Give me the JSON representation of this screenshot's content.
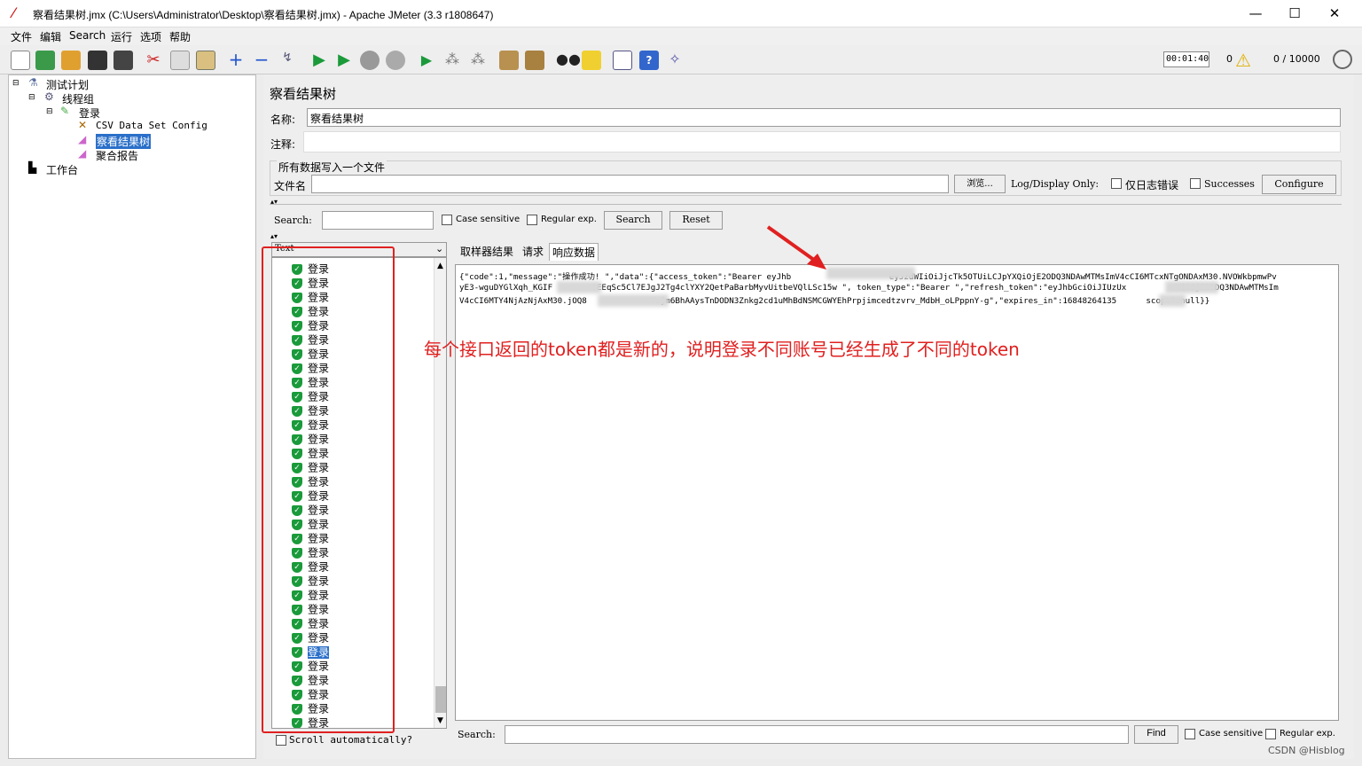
{
  "window": {
    "title": "察看结果树.jmx (C:\\Users\\Administrator\\Desktop\\察看结果树.jmx) - Apache JMeter (3.3 r1808647)",
    "minimize": "—",
    "maximize": "☐",
    "close": "✕"
  },
  "menu": [
    "文件",
    "编辑",
    "Search",
    "运行",
    "选项",
    "帮助"
  ],
  "toolbar": {
    "timer": "00:01:40",
    "errors": "0",
    "threads": "0 / 10000",
    "icons": [
      "new-icon",
      "templates-icon",
      "open-icon",
      "save-icon",
      "save-as-icon",
      "cut-icon",
      "copy-icon",
      "paste-icon",
      "expand-icon",
      "collapse-icon",
      "toggle-icon",
      "start-icon",
      "start-no-pause-icon",
      "stop-icon",
      "shutdown-icon",
      "remote-start-icon",
      "remote-stop-icon",
      "remote-shutdown-icon",
      "clear-icon",
      "clear-all-icon",
      "search-icon",
      "reset-search-icon",
      "function-helper-icon",
      "help-icon",
      "log-icon"
    ]
  },
  "tree": {
    "plan": "测试计划",
    "threadgroup": "线程组",
    "sampler": "登录",
    "csv": "CSV Data Set Config",
    "viewer": "察看结果树",
    "aggregate": "聚合报告",
    "workbench": "工作台"
  },
  "panel": {
    "title": "察看结果树",
    "name_label": "名称:",
    "name_value": "察看结果树",
    "comment_label": "注释:",
    "file_group": "所有数据写入一个文件",
    "filename_label": "文件名",
    "browse": "浏览...",
    "log_display": "Log/Display Only:",
    "errors_only": "仅日志错误",
    "successes": "Successes",
    "configure": "Configure",
    "search_label": "Search:",
    "case_sensitive": "Case sensitive",
    "regex": "Regular exp.",
    "search_btn": "Search",
    "reset_btn": "Reset",
    "list_header": "Text",
    "scroll_auto": "Scroll automatically?",
    "tabs": [
      "取样器结果",
      "请求",
      "响应数据"
    ],
    "bottom_search_label": "Search:",
    "find_btn": "Find",
    "case_sensitive2": "Case sensitive",
    "regex2": "Regular exp."
  },
  "results": {
    "label": "登录",
    "count": 33,
    "selected_index": 27
  },
  "response": {
    "line1": "{\"code\":1,\"message\":\"操作成功! \",\"data\":{\"access_token\":\"Bearer eyJhb                    eyJzdWIiOiJjcTk5OTUiLCJpYXQiOjE2ODQ3NDAwMTMsImV4cCI6MTcxNTgONDAxM30.NVOWkbpmwPv",
    "line2": "yE3-wguDYGlXqh_KGIF        0EEqSc5Cl7EJgJ2Tg4clYXY2QetPaBarbMyvUitbeVQlLSc15w \", token_type\":\"Bearer \",\"refresh_token\":\"eyJhbGciOiJIUzUx          XQiOjE2ODQ3NDAwMTMsIm",
    "line3": "V4cCI6MTY4NjAzNjAxM30.jOQ8             Vzjm6BhAAysTnDODN3Znkg2cd1uMhBdNSMCGWYEhPrpjimcedtzvrv_MdbH_oLPppnY-g\",\"expires_in\":16848264135      scope\":null}}"
  },
  "annotation": "每个接口返回的token都是新的，说明登录不同账号已经生成了不同的token",
  "watermark": "CSDN @Hisblog",
  "colors": {
    "annotation": "#e02020",
    "selection": "#2a6fc9",
    "success": "#1a9a3a"
  }
}
